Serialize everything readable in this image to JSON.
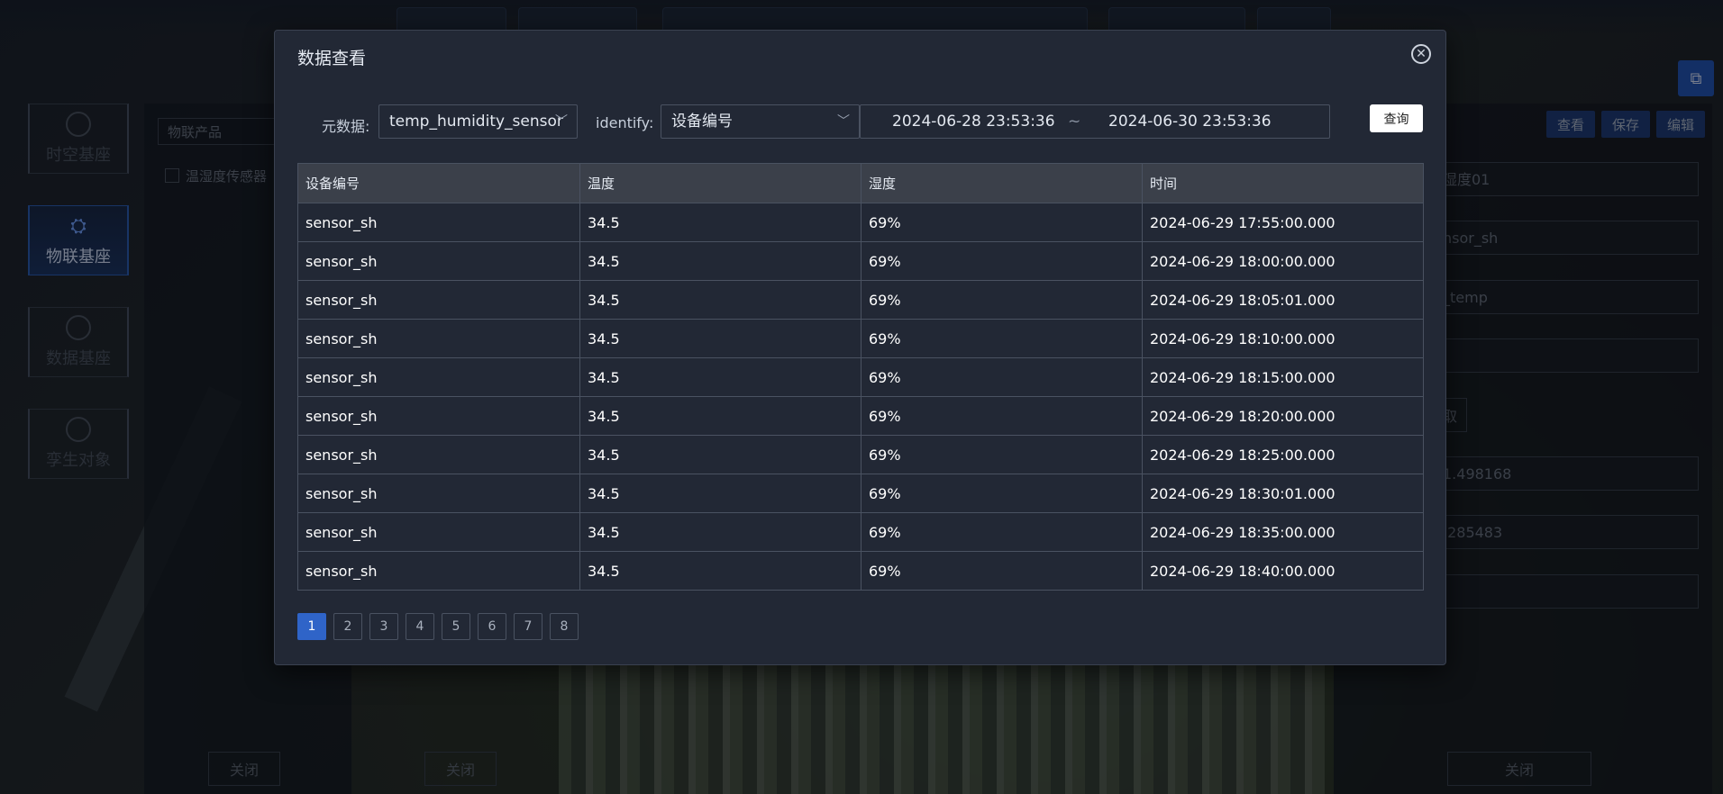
{
  "sidebar": {
    "items": [
      {
        "label": "时空基座",
        "icon": "compass-icon"
      },
      {
        "label": "物联基座",
        "icon": "network-icon"
      },
      {
        "label": "数据基座",
        "icon": "database-icon"
      },
      {
        "label": "孪生对象",
        "icon": "cubes-icon"
      }
    ]
  },
  "left_panel": {
    "product_select": "物联产品",
    "checkbox_label": "温湿度传感器"
  },
  "right_panel": {
    "buttons": {
      "view": "查看",
      "save": "保存",
      "edit": "编辑"
    },
    "fields": [
      "湿度01",
      "nsor_sh",
      "_temp",
      "",
      "1.498168",
      ".285483",
      ""
    ],
    "small_button": "取"
  },
  "background_close_label": "关闭",
  "modal": {
    "title": "数据查看",
    "filters": {
      "metadata_label": "元数据:",
      "metadata_value": "temp_humidity_sensor",
      "identify_label": "identify:",
      "identify_value": "设备编号",
      "date_start": "2024-06-28 23:53:36",
      "date_sep": "~",
      "date_end": "2024-06-30 23:53:36",
      "query_label": "查询"
    },
    "table": {
      "headers": [
        "设备编号",
        "温度",
        "湿度",
        "时间"
      ],
      "rows": [
        [
          "sensor_sh",
          "34.5",
          "69%",
          "2024-06-29 17:55:00.000"
        ],
        [
          "sensor_sh",
          "34.5",
          "69%",
          "2024-06-29 18:00:00.000"
        ],
        [
          "sensor_sh",
          "34.5",
          "69%",
          "2024-06-29 18:05:01.000"
        ],
        [
          "sensor_sh",
          "34.5",
          "69%",
          "2024-06-29 18:10:00.000"
        ],
        [
          "sensor_sh",
          "34.5",
          "69%",
          "2024-06-29 18:15:00.000"
        ],
        [
          "sensor_sh",
          "34.5",
          "69%",
          "2024-06-29 18:20:00.000"
        ],
        [
          "sensor_sh",
          "34.5",
          "69%",
          "2024-06-29 18:25:00.000"
        ],
        [
          "sensor_sh",
          "34.5",
          "69%",
          "2024-06-29 18:30:01.000"
        ],
        [
          "sensor_sh",
          "34.5",
          "69%",
          "2024-06-29 18:35:00.000"
        ],
        [
          "sensor_sh",
          "34.5",
          "69%",
          "2024-06-29 18:40:00.000"
        ]
      ]
    },
    "pagination": {
      "pages": [
        "1",
        "2",
        "3",
        "4",
        "5",
        "6",
        "7",
        "8"
      ],
      "current": "1"
    }
  },
  "colors": {
    "accent": "#2f64c8",
    "modal_bg": "#222835",
    "header_bg": "#3b404a"
  }
}
